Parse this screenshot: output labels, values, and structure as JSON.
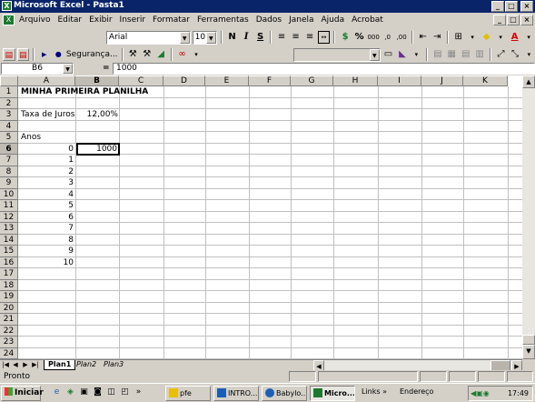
{
  "window": {
    "title": "Microsoft Excel - Pasta1",
    "app_icon": "X",
    "min": "_",
    "max": "□",
    "close": "×"
  },
  "menu": [
    "Arquivo",
    "Editar",
    "Exibir",
    "Inserir",
    "Formatar",
    "Ferramentas",
    "Dados",
    "Janela",
    "Ajuda",
    "Acrobat"
  ],
  "toolbar": {
    "font": "Arial",
    "size": "10",
    "bold": "N",
    "italic": "I",
    "underline": "S",
    "percent": "%",
    "thousands": "000",
    "security": "Segurança...",
    "merge_center": "↔",
    "currency": "$",
    "inc_dec": ",0",
    "dec_dec": ",00"
  },
  "formula_bar": {
    "name_box": "B6",
    "equals": "=",
    "value": "1000"
  },
  "columns": [
    "A",
    "B",
    "C",
    "D",
    "E",
    "F",
    "G",
    "H",
    "I",
    "J",
    "K"
  ],
  "rows": [
    "1",
    "2",
    "3",
    "4",
    "5",
    "6",
    "7",
    "8",
    "9",
    "10",
    "11",
    "12",
    "13",
    "14",
    "15",
    "16",
    "17",
    "18",
    "19",
    "20",
    "21",
    "22",
    "23",
    "24"
  ],
  "cells": {
    "a1": "MINHA PRIMEIRA PLANILHA",
    "a3": "Taxa de Juros",
    "b3": "12,00%",
    "a5": "Anos",
    "b6": "1000",
    "years": [
      "0",
      "1",
      "2",
      "3",
      "4",
      "5",
      "6",
      "7",
      "8",
      "9",
      "10"
    ]
  },
  "sheet_tabs": [
    "Plan1",
    "Plan2",
    "Plan3"
  ],
  "status": "Pronto",
  "taskbar": {
    "start": "Iniciar",
    "buttons": [
      "pfe",
      "INTRO...",
      "Babylo...",
      "Micro..."
    ],
    "links": "Links",
    "links_chevron": "»",
    "endereco": "Endereço",
    "quicklaunch_chevron": "»",
    "clock": "17:49"
  },
  "colors": {
    "title_bar": "#0a246a",
    "excel_green": "#1b7a2e",
    "selection": "#000000"
  }
}
